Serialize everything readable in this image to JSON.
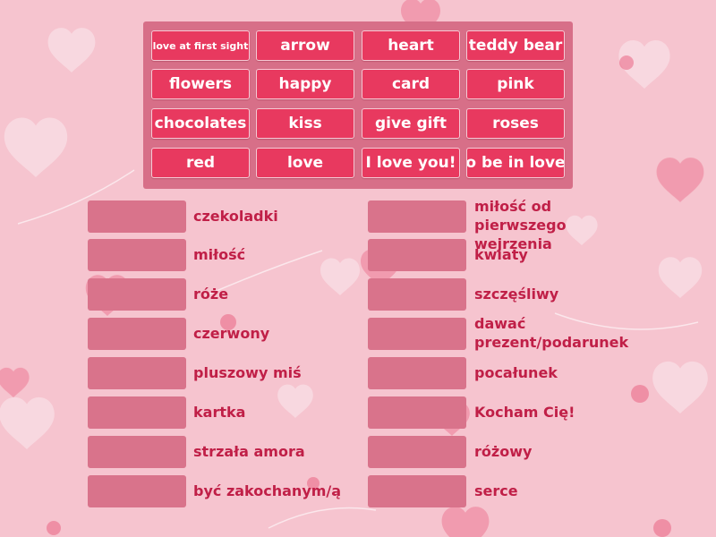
{
  "word_bank": [
    "love at first sight",
    "arrow",
    "heart",
    "teddy bear",
    "flowers",
    "happy",
    "card",
    "pink",
    "chocolates",
    "kiss",
    "give gift",
    "roses",
    "red",
    "love",
    "I love you!",
    "o be in love"
  ],
  "left_column": [
    "czekoladki",
    "miłość",
    "róże",
    "czerwony",
    "pluszowy miś",
    "kartka",
    "strzała amora",
    "być zakochanym/ą"
  ],
  "right_column": [
    "miłość od pierwszego wejrzenia",
    "kwiaty",
    "szczęśliwy",
    "dawać prezent/podarunek",
    "pocałunek",
    "Kocham Cię!",
    "różowy",
    "serce"
  ],
  "colors": {
    "background": "#f6c4cf",
    "bank": "#d76f88",
    "tile": "#e8395f",
    "slot": "#d9738b",
    "label": "#c01f47"
  }
}
